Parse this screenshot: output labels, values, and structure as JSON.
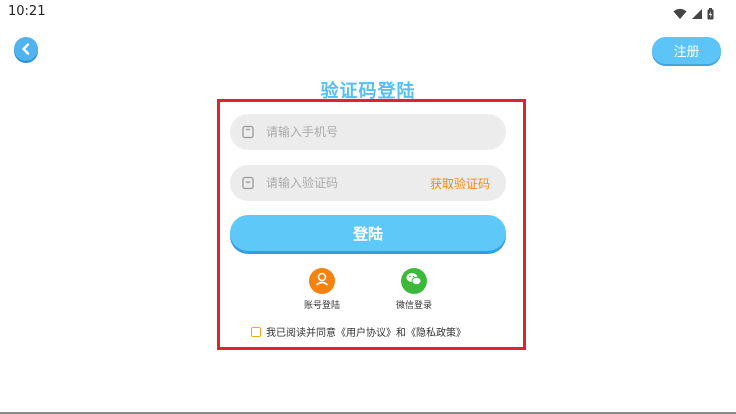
{
  "status_bar": {
    "time": "10:21"
  },
  "header": {
    "register_label": "注册"
  },
  "title": "验证码登陆",
  "form": {
    "phone_placeholder": "请输入手机号",
    "code_placeholder": "请输入验证码",
    "get_code_label": "获取验证码",
    "login_label": "登陆"
  },
  "alt_logins": [
    {
      "label": "账号登陆",
      "color": "#f5820f",
      "icon": "user-icon"
    },
    {
      "label": "微信登录",
      "color": "#3cb93a",
      "icon": "wechat-icon"
    }
  ],
  "agreement": {
    "text": "我已阅读并同意《用户协议》和《隐私政策》"
  },
  "colors": {
    "accent": "#5ec8f9",
    "title": "#56c0f5",
    "highlight": "#e3232c",
    "link": "#f08a1d"
  }
}
